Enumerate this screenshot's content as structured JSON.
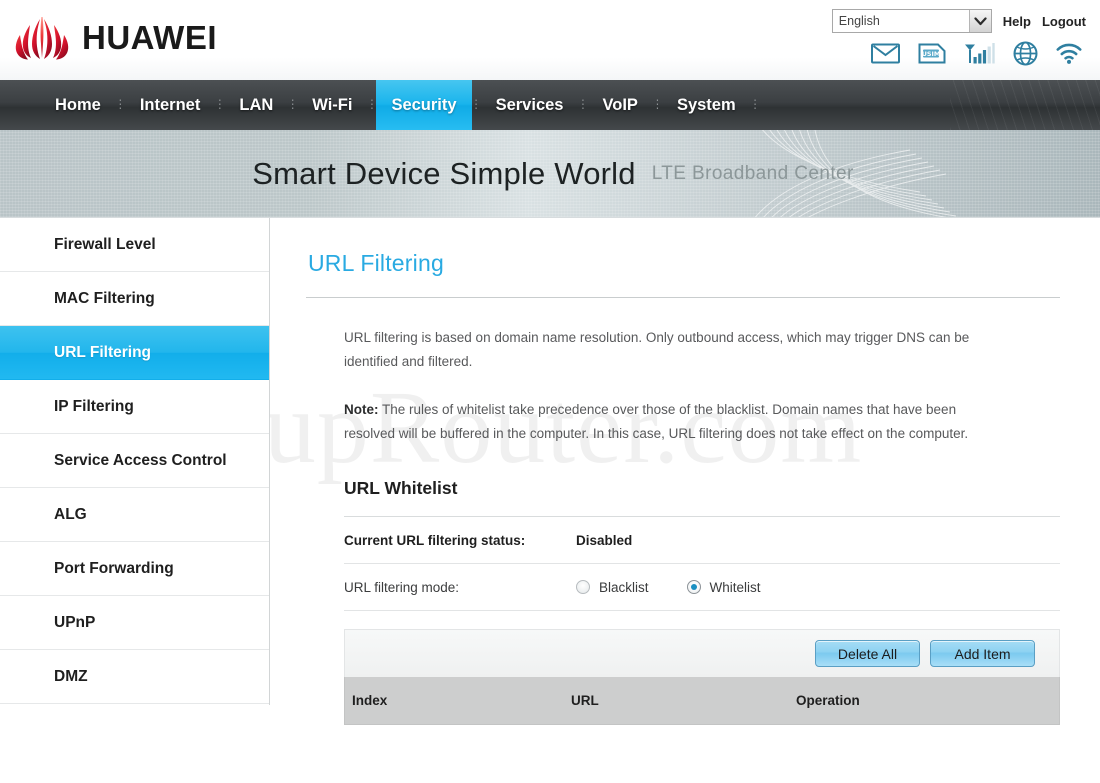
{
  "header": {
    "brand": "HUAWEI",
    "language_value": "English",
    "help_label": "Help",
    "logout_label": "Logout",
    "status_icons": [
      {
        "name": "mail-icon",
        "label": "Mail"
      },
      {
        "name": "usim-icon",
        "label": "USIM"
      },
      {
        "name": "signal-icon",
        "label": "Signal"
      },
      {
        "name": "globe-icon",
        "label": "Network"
      },
      {
        "name": "wifi-icon",
        "label": "Wi-Fi"
      }
    ]
  },
  "nav": {
    "items": [
      {
        "label": "Home",
        "active": false
      },
      {
        "label": "Internet",
        "active": false
      },
      {
        "label": "LAN",
        "active": false
      },
      {
        "label": "Wi-Fi",
        "active": false
      },
      {
        "label": "Security",
        "active": true
      },
      {
        "label": "Services",
        "active": false
      },
      {
        "label": "VoIP",
        "active": false
      },
      {
        "label": "System",
        "active": false
      }
    ]
  },
  "banner": {
    "main": "Smart Device   Simple World",
    "sub": "LTE Broadband Center"
  },
  "watermark": {
    "text": "SetupRouter.com"
  },
  "sidebar": {
    "items": [
      {
        "label": "Firewall Level",
        "active": false
      },
      {
        "label": "MAC Filtering",
        "active": false
      },
      {
        "label": "URL Filtering",
        "active": true
      },
      {
        "label": "IP Filtering",
        "active": false
      },
      {
        "label": "Service Access Control",
        "active": false
      },
      {
        "label": "ALG",
        "active": false
      },
      {
        "label": "Port Forwarding",
        "active": false
      },
      {
        "label": "UPnP",
        "active": false
      },
      {
        "label": "DMZ",
        "active": false
      }
    ]
  },
  "main": {
    "title": "URL Filtering",
    "description": "URL filtering is based on domain name resolution. Only outbound access, which may trigger DNS can be identified and filtered.",
    "note_label": "Note:",
    "note_text": " The rules of whitelist take precedence over those of the blacklist. Domain names that have been resolved will be buffered in the computer. In this case, URL filtering does not take effect on the computer.",
    "section_title": "URL Whitelist",
    "status_row": {
      "label": "Current URL filtering status:",
      "value": "Disabled"
    },
    "mode_row": {
      "label": "URL filtering mode:",
      "options": [
        {
          "label": "Blacklist",
          "checked": false
        },
        {
          "label": "Whitelist",
          "checked": true
        }
      ]
    },
    "table": {
      "delete_all_label": "Delete All",
      "add_item_label": "Add Item",
      "columns": [
        "Index",
        "URL",
        "Operation"
      ],
      "rows": []
    }
  },
  "colors": {
    "accent": "#29aae2",
    "nav_active": "#19b4ec",
    "sidebar_active": "#22b6ec",
    "button_blue": "#8fd3f2",
    "table_head": "#cdcece",
    "brand_red": "#cf0a2c"
  }
}
